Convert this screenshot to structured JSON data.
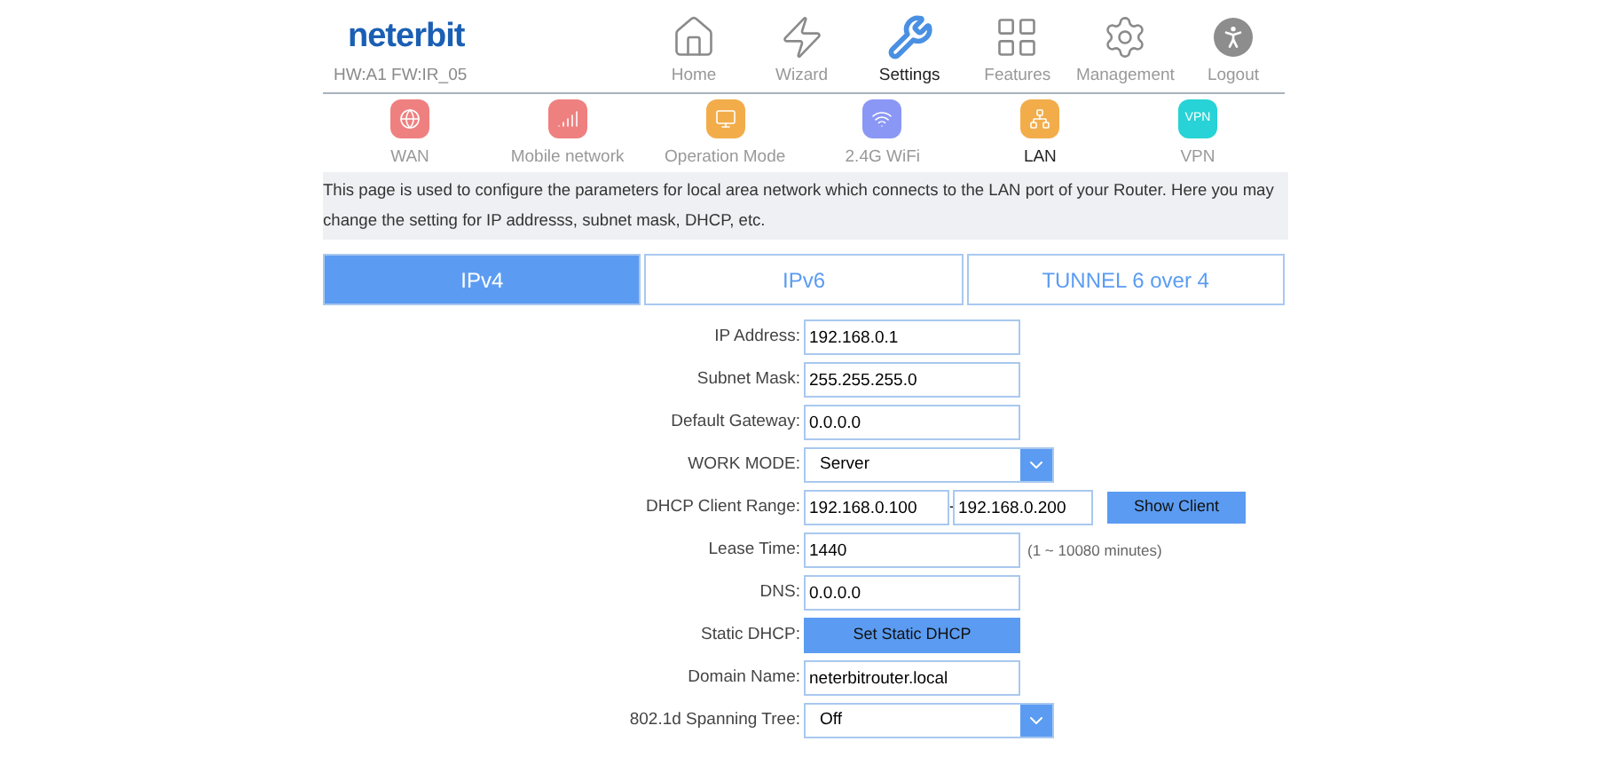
{
  "header": {
    "logo": "neterbit",
    "version": "HW:A1 FW:IR_05"
  },
  "nav": [
    {
      "label": "Home",
      "kind": "home",
      "selected": false
    },
    {
      "label": "Wizard",
      "kind": "wizard",
      "selected": false
    },
    {
      "label": "Settings",
      "kind": "settings",
      "selected": true
    },
    {
      "label": "Features",
      "kind": "features",
      "selected": false
    },
    {
      "label": "Management",
      "kind": "management",
      "selected": false
    },
    {
      "label": "Logout",
      "kind": "logout",
      "selected": false
    }
  ],
  "subnav": [
    {
      "label": "WAN",
      "kind": "wan",
      "color": "#ef8080",
      "selected": false
    },
    {
      "label": "Mobile network",
      "kind": "mobile",
      "color": "#ef8080",
      "selected": false
    },
    {
      "label": "Operation Mode",
      "kind": "mode",
      "color": "#f2ad4a",
      "selected": false
    },
    {
      "label": "2.4G WiFi",
      "kind": "wifi",
      "color": "#8b97f5",
      "selected": false
    },
    {
      "label": "LAN",
      "kind": "lan",
      "color": "#f2ad4a",
      "selected": true
    },
    {
      "label": "VPN",
      "kind": "vpn",
      "color": "#27d3d6",
      "selected": false,
      "icon_text": "VPN"
    }
  ],
  "description": "This page is used to configure the parameters for local area network which connects to the LAN port of your Router. Here you may change the setting for IP addresss, subnet mask, DHCP, etc.",
  "tabs": [
    {
      "label": "IPv4",
      "selected": true
    },
    {
      "label": "IPv6",
      "selected": false
    },
    {
      "label": "TUNNEL 6 over 4",
      "selected": false
    }
  ],
  "form": [
    {
      "kind": "text",
      "label": "IP Address:",
      "value": "192.168.0.1"
    },
    {
      "kind": "text",
      "label": "Subnet Mask:",
      "value": "255.255.255.0"
    },
    {
      "kind": "text",
      "label": "Default Gateway:",
      "value": "0.0.0.0"
    },
    {
      "kind": "select",
      "label": "WORK MODE:",
      "value": "Server"
    },
    {
      "kind": "range",
      "label": "DHCP Client Range:",
      "value": "192.168.0.100",
      "separator": "-",
      "value_end": "192.168.0.200",
      "button": "Show Client"
    },
    {
      "kind": "text",
      "label": "Lease Time:",
      "value": "1440",
      "hint": "(1 ~ 10080 minutes)"
    },
    {
      "kind": "text",
      "label": "DNS:",
      "value": "0.0.0.0"
    },
    {
      "kind": "button",
      "label": "Static DHCP:",
      "button": "Set Static DHCP"
    },
    {
      "kind": "text",
      "label": "Domain Name:",
      "value": "neterbitrouter.local"
    },
    {
      "kind": "select",
      "label": "802.1d Spanning Tree:",
      "value": "Off"
    }
  ]
}
